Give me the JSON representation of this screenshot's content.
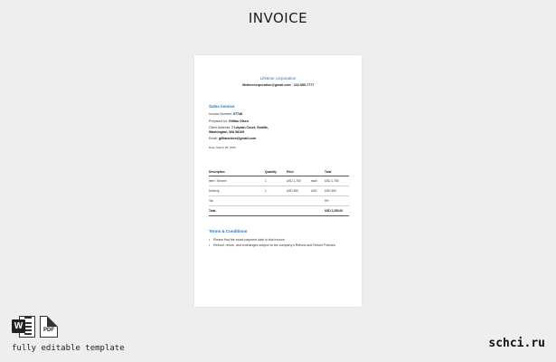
{
  "page_heading": "INVOICE",
  "sheet": {
    "company_name": "Lifetime corporation",
    "company_contact": "lifetimecorporation@gmail.com · 222-555-7777",
    "sales_invoice_title": "Sales invoice",
    "invoice_number_label": "Invoice Number:",
    "invoice_number": "07748",
    "prepared_for_label": "Prepared for:",
    "prepared_for": "Gillian Olsen",
    "client_address_label": "Client Address:",
    "client_address_1": "7 Laysan Court, Seattle,",
    "client_address_2": "Washington, WA 98109",
    "email_label": "Email:",
    "email": "gillianolsen@gmail.com",
    "date_line": "Date: March 25, 2025",
    "table": {
      "headers": [
        "Description",
        "Quantity",
        "Price",
        "",
        "Total"
      ],
      "rows": [
        [
          "Item / Service",
          "1",
          "USD 1,750",
          "each",
          "USD 1,750"
        ],
        [
          "Delivery",
          "1",
          "USD 500",
          "USD",
          "USD 500"
        ],
        [
          "Tax",
          "",
          "",
          "",
          "5%"
        ]
      ],
      "total_label": "Total",
      "total_value": "USD 2,250.00"
    },
    "terms_title": "Terms & Conditions",
    "terms": [
      "Please find the exact payment date in this invoice.",
      "Refund, return, and exchanges subject to the company's Refund and Return Policies."
    ]
  },
  "footer": {
    "word_badge": "W",
    "pdf_label": "PDF",
    "caption": "fully editable template",
    "brand": "schci.ru"
  }
}
